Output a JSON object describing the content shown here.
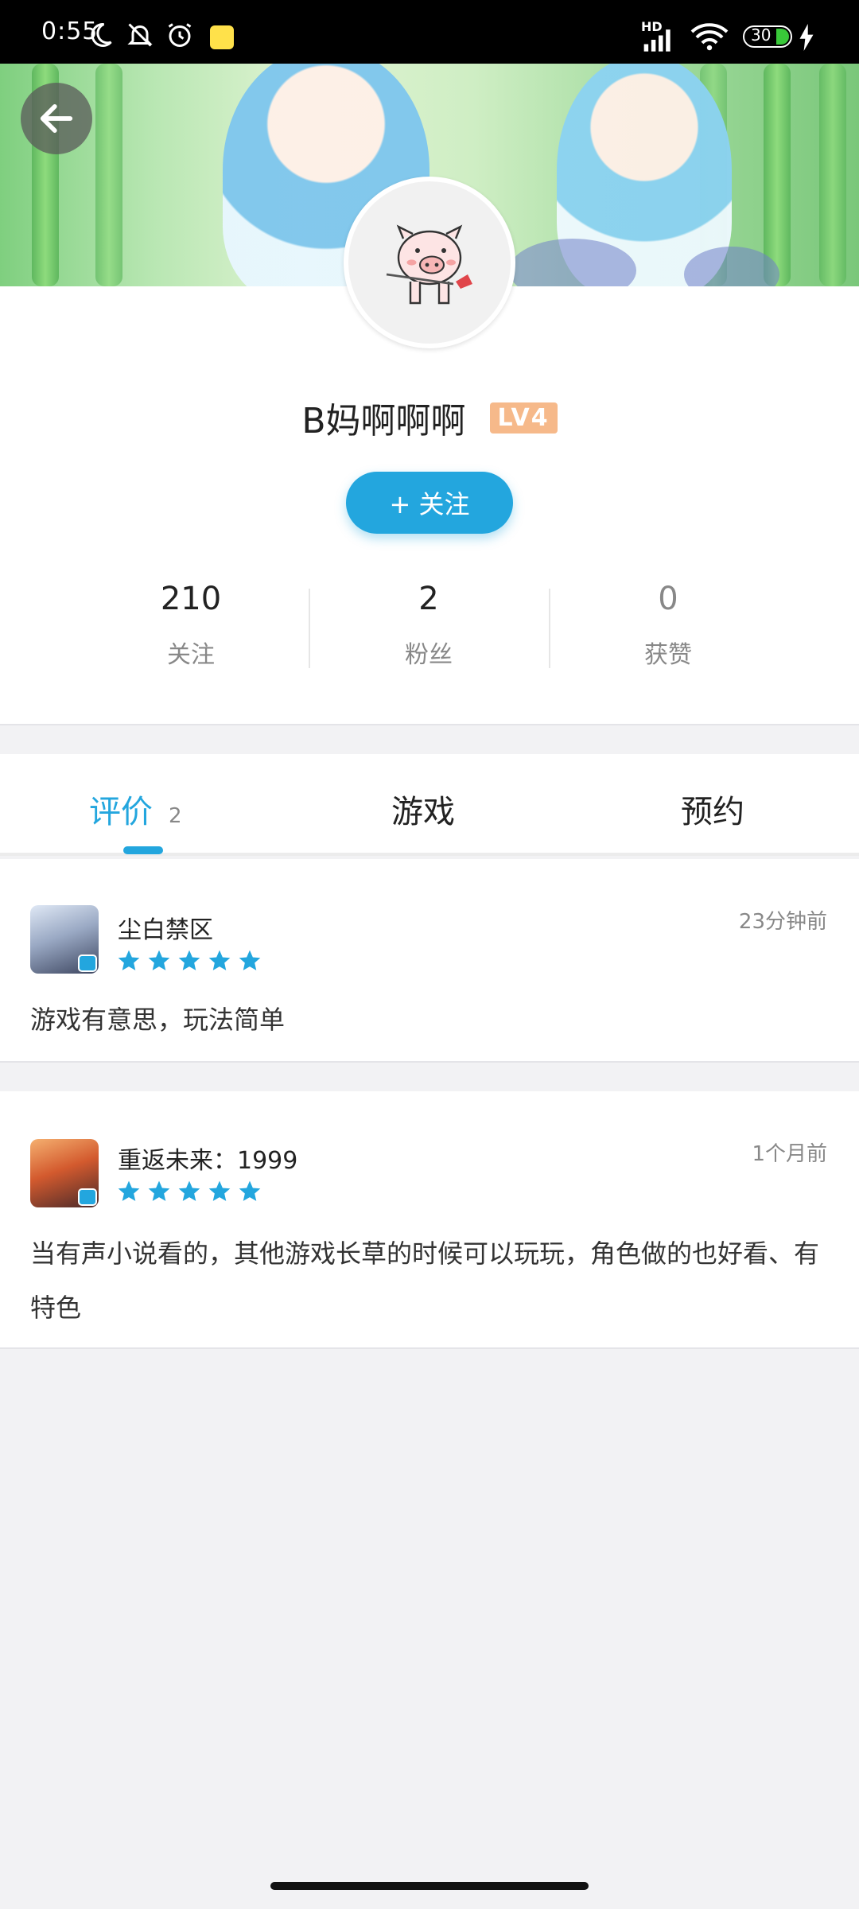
{
  "status_bar": {
    "time": "0:55",
    "battery": "30",
    "network_label": "HD"
  },
  "profile": {
    "name": "B妈啊啊啊",
    "level": "LV4",
    "follow_label": "+ 关注",
    "stats": [
      {
        "value": "210",
        "label": "关注"
      },
      {
        "value": "2",
        "label": "粉丝"
      },
      {
        "value": "0",
        "label": "获赞"
      }
    ]
  },
  "tabs": [
    {
      "label": "评价",
      "count": "2",
      "active": true
    },
    {
      "label": "游戏",
      "active": false
    },
    {
      "label": "预约",
      "active": false
    }
  ],
  "reviews": [
    {
      "game": "尘白禁区",
      "rating": 5,
      "time": "23分钟前",
      "text": "游戏有意思，玩法简单"
    },
    {
      "game": "重返未来：1999",
      "rating": 5,
      "time": "1个月前",
      "text": "当有声小说看的，其他游戏长草的时候可以玩玩，角色做的也好看、有特色"
    }
  ],
  "colors": {
    "accent": "#23a6de",
    "level_badge": "#f6b98a",
    "star": "#23a6de"
  }
}
